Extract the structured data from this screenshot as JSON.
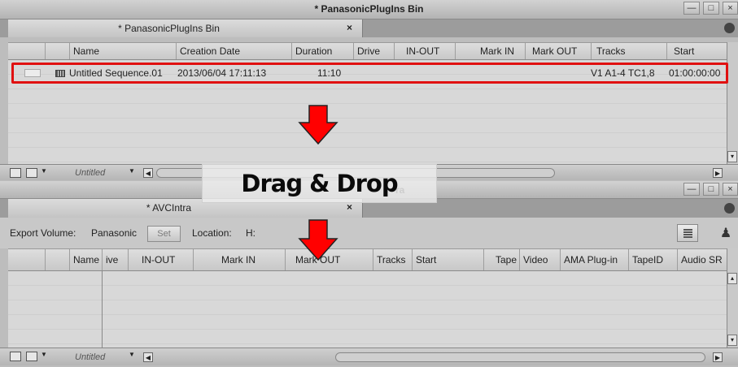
{
  "top_window": {
    "title": "* PanasonicPlugIns Bin",
    "tab_label": "* PanasonicPlugIns Bin",
    "tab_close": "×",
    "columns": [
      "Name",
      "Creation Date",
      "Duration",
      "Drive",
      "IN-OUT",
      "Mark IN",
      "Mark OUT",
      "Tracks",
      "Start"
    ],
    "row": {
      "name": "Untitled Sequence.01",
      "creation_date": "2013/06/04 17:11:13",
      "duration": "11:10",
      "tracks": "V1 A1-4 TC1,8",
      "start": "01:00:00:00"
    },
    "bottom_label": "Untitled"
  },
  "bottom_window": {
    "title_fragment": "ra",
    "tab_label": "* AVCIntra",
    "tab_close": "×",
    "export_volume_label": "Export Volume:",
    "export_volume_value": "Panasonic",
    "set_button": "Set",
    "location_label": "Location:",
    "location_value": "H:",
    "columns": [
      "Name",
      "ive",
      "IN-OUT",
      "Mark IN",
      "Mark OUT",
      "Tracks",
      "Start",
      "Tape",
      "Video",
      "AMA Plug-in",
      "TapeID",
      "Audio SR"
    ],
    "bottom_label": "Untitled"
  },
  "overlay": {
    "banner_text": "Drag & Drop",
    "arrow_color": "#ff0000",
    "highlight_color": "#e01010"
  },
  "window_buttons": {
    "minimize": "—",
    "maximize": "□",
    "close": "×"
  }
}
